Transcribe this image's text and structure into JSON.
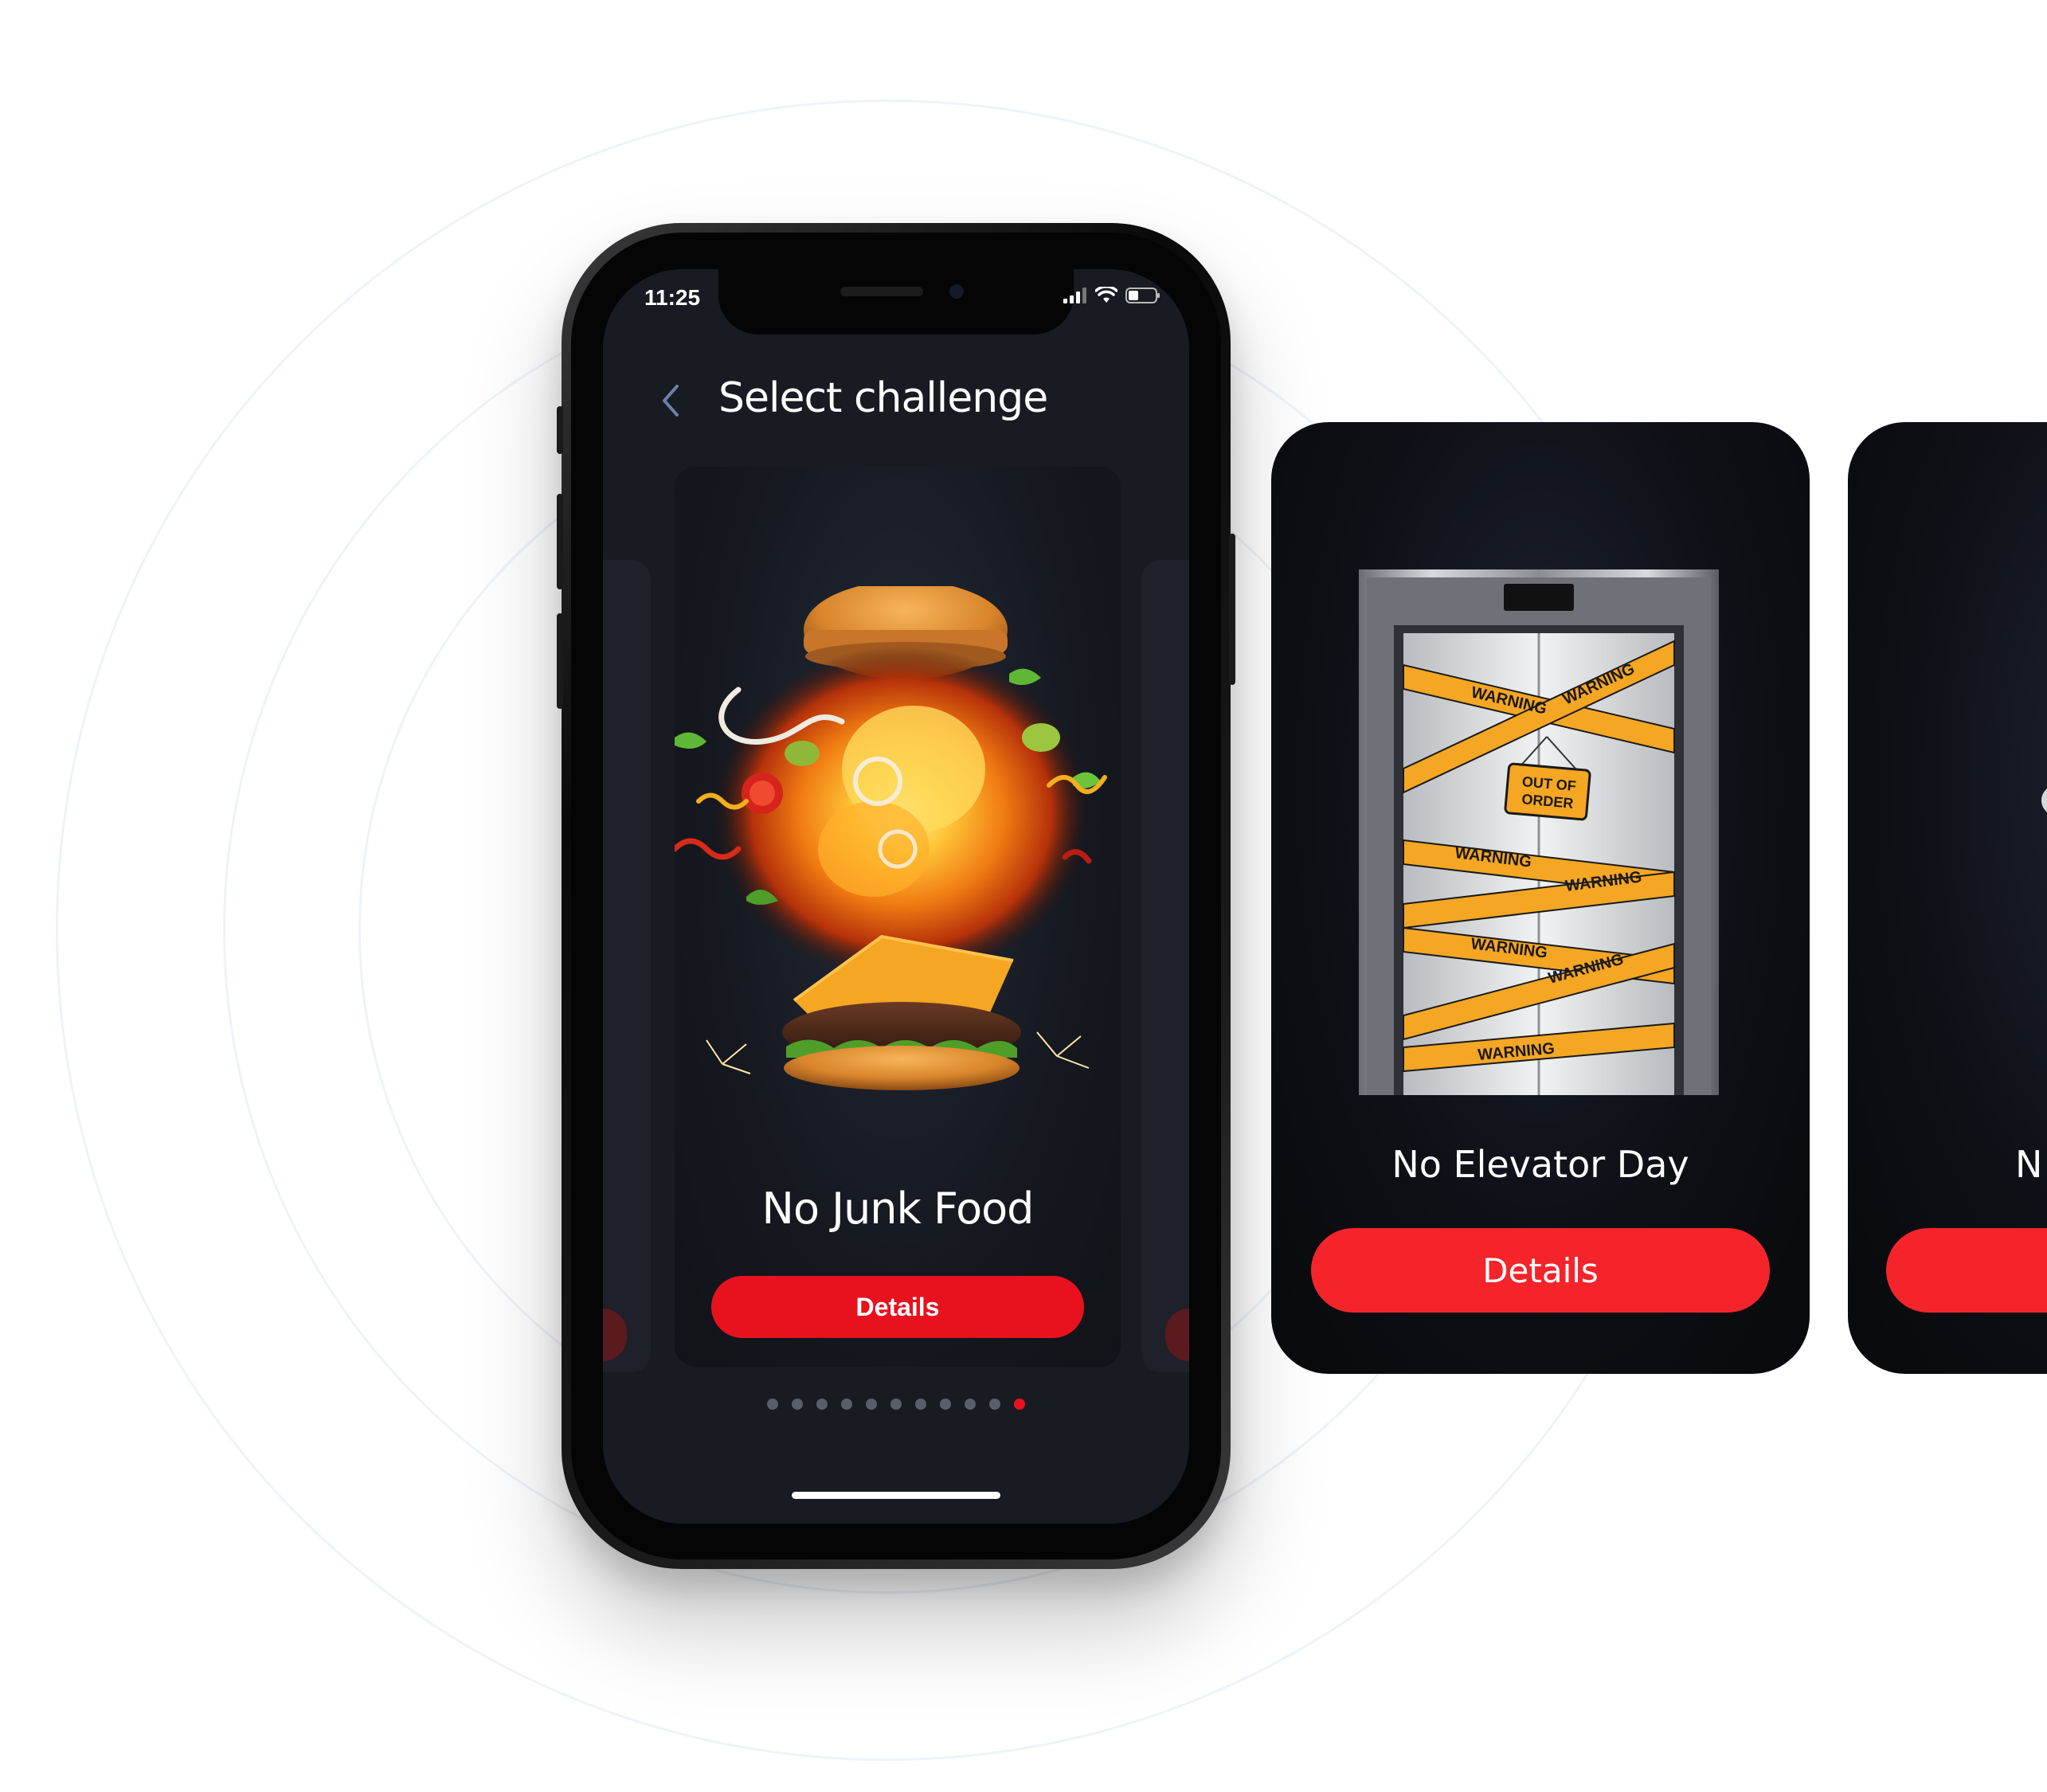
{
  "status_bar": {
    "time": "11:25",
    "icons": [
      "signal-icon",
      "wifi-icon",
      "battery-icon"
    ]
  },
  "header": {
    "back_icon": "chevron-left-icon",
    "title": "Select challenge"
  },
  "active_card": {
    "title": "No Junk Food",
    "button_label": "Details",
    "image": "burger-explosion"
  },
  "pager": {
    "total": 11,
    "active_index": 10
  },
  "side_cards": [
    {
      "title": "No Elevator Day",
      "button_label": "Details",
      "image": "elevator-warning-tape",
      "sign_text": "OUT OF ORDER",
      "tape_text": "WARNING"
    },
    {
      "title": "N",
      "button_label": "",
      "image": "chained-phone"
    }
  ],
  "colors": {
    "accent": "#e8121e",
    "button_red": "#f5242a",
    "screen_bg": "#181b22",
    "tape": "#f5a623"
  }
}
